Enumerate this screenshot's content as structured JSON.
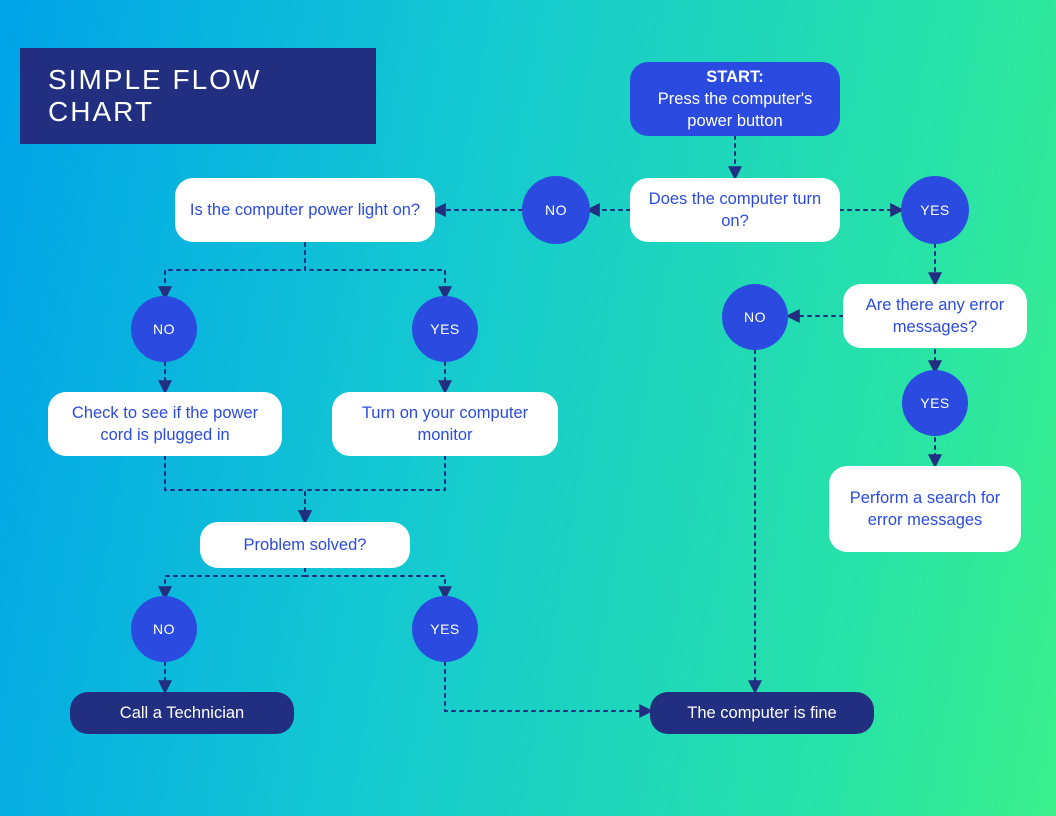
{
  "title": "SIMPLE FLOW CHART",
  "nodes": {
    "start": {
      "label_strong": "START:",
      "label_rest": "Press the computer's power button"
    },
    "turn_on": "Does the computer turn on?",
    "power_light": "Is the computer power light on?",
    "error_msgs": "Are there any error messages?",
    "check_cord": "Check to see if the power cord is plugged in",
    "turn_monitor": "Turn on your computer monitor",
    "problem_solved": "Problem solved?",
    "search_errors": "Perform a search for error messages",
    "call_tech": "Call a Technician",
    "computer_fine": "The computer is fine"
  },
  "labels": {
    "yes": "YES",
    "no": "NO"
  },
  "colors": {
    "primary_blue": "#2B4BE0",
    "dark_navy": "#222E80",
    "white": "#FFFFFF"
  },
  "chart_data": {
    "type": "flowchart",
    "title": "SIMPLE FLOW CHART",
    "nodes": [
      {
        "id": "start",
        "kind": "start",
        "text": "START: Press the computer's power button"
      },
      {
        "id": "turn_on",
        "kind": "decision",
        "text": "Does the computer turn on?"
      },
      {
        "id": "power_light",
        "kind": "decision",
        "text": "Is the computer power light on?"
      },
      {
        "id": "error_msgs",
        "kind": "decision",
        "text": "Are there any error messages?"
      },
      {
        "id": "check_cord",
        "kind": "process",
        "text": "Check to see if the power cord is plugged in"
      },
      {
        "id": "turn_monitor",
        "kind": "process",
        "text": "Turn on your computer monitor"
      },
      {
        "id": "problem_solved",
        "kind": "decision",
        "text": "Problem solved?"
      },
      {
        "id": "search_errors",
        "kind": "process",
        "text": "Perform a search for error messages"
      },
      {
        "id": "call_tech",
        "kind": "end",
        "text": "Call a Technician"
      },
      {
        "id": "computer_fine",
        "kind": "end",
        "text": "The computer is fine"
      }
    ],
    "edges": [
      {
        "from": "start",
        "to": "turn_on",
        "label": ""
      },
      {
        "from": "turn_on",
        "to": "power_light",
        "label": "NO"
      },
      {
        "from": "turn_on",
        "to": "error_msgs",
        "label": "YES"
      },
      {
        "from": "power_light",
        "to": "check_cord",
        "label": "NO"
      },
      {
        "from": "power_light",
        "to": "turn_monitor",
        "label": "YES"
      },
      {
        "from": "check_cord",
        "to": "problem_solved",
        "label": ""
      },
      {
        "from": "turn_monitor",
        "to": "problem_solved",
        "label": ""
      },
      {
        "from": "problem_solved",
        "to": "call_tech",
        "label": "NO"
      },
      {
        "from": "problem_solved",
        "to": "computer_fine",
        "label": "YES"
      },
      {
        "from": "error_msgs",
        "to": "computer_fine",
        "label": "NO"
      },
      {
        "from": "error_msgs",
        "to": "search_errors",
        "label": "YES"
      }
    ]
  }
}
